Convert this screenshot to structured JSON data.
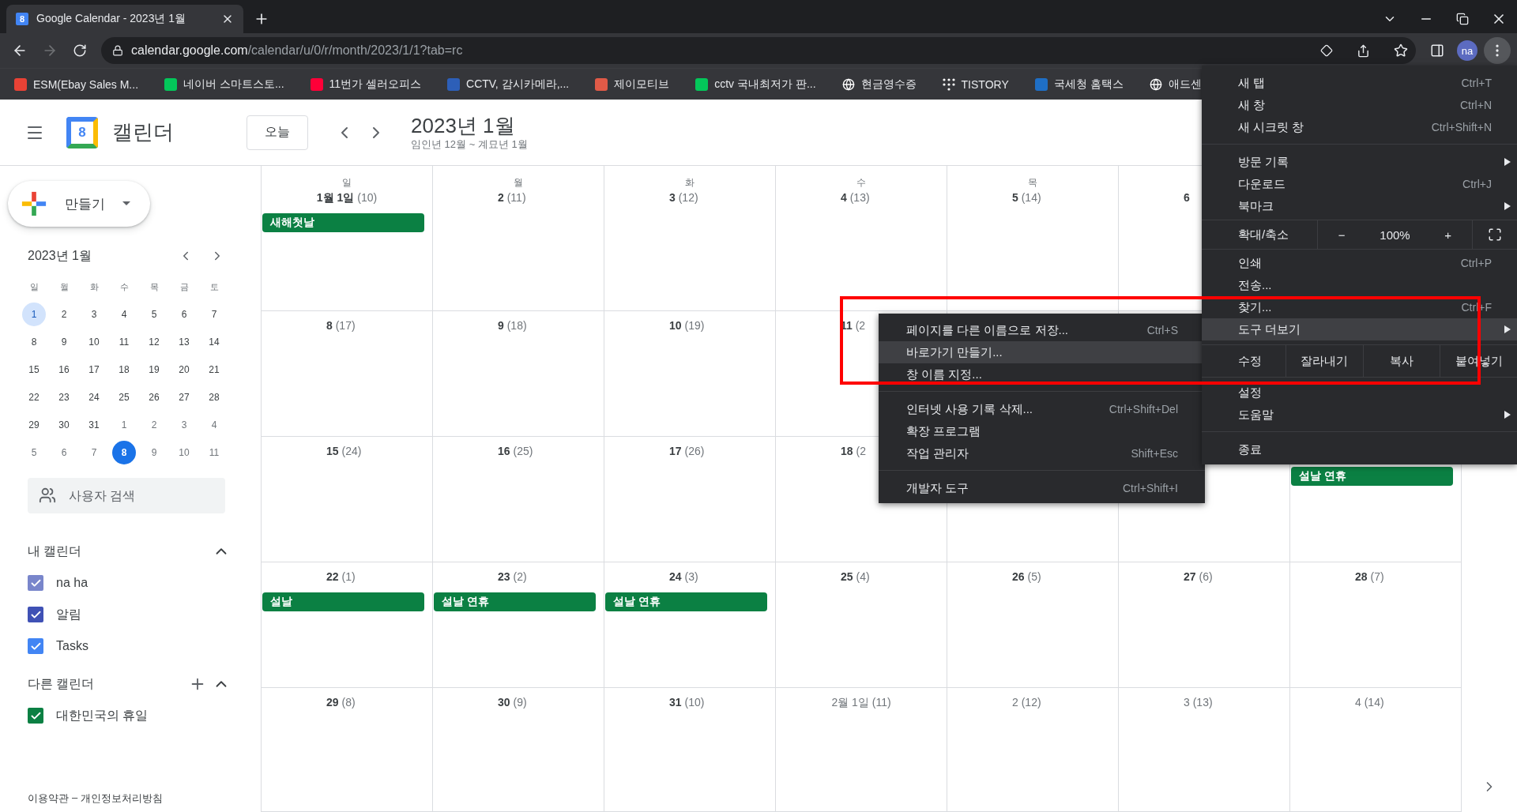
{
  "browser": {
    "tab": {
      "favicon_text": "8",
      "title": "Google Calendar - 2023년 1월"
    },
    "address": {
      "host": "calendar.google.com",
      "path": "/calendar/u/0/r/month/2023/1/1?tab=rc"
    },
    "profile": "na",
    "bookmarks": [
      {
        "kind": "square",
        "color": "#e94235",
        "label": "ESM(Ebay Sales M..."
      },
      {
        "kind": "square",
        "color": "#03c75a",
        "label": "네이버 스마트스토..."
      },
      {
        "kind": "square",
        "color": "#ff0038",
        "label": "11번가 셀러오피스"
      },
      {
        "kind": "square",
        "color": "#2d5fb8",
        "label": "CCTV, 감시카메라,..."
      },
      {
        "kind": "square",
        "color": "#e05a47",
        "label": "제이모티브"
      },
      {
        "kind": "square",
        "color": "#03c75a",
        "label": "cctv 국내최저가 판..."
      },
      {
        "kind": "globe",
        "color": "#ffffff",
        "label": "현금영수증"
      },
      {
        "kind": "dots",
        "color": "#ffffff",
        "label": "TISTORY"
      },
      {
        "kind": "square",
        "color": "#1f6fc5",
        "label": "국세청 홈택스"
      },
      {
        "kind": "globe",
        "color": "#ffffff",
        "label": "애드센"
      }
    ]
  },
  "app": {
    "logo_text": "8",
    "name": "캘린더",
    "today_button": "오늘",
    "title": "2023년 1월",
    "subtitle": "임인년 12월 ~ 계묘년 1월"
  },
  "sidebar": {
    "create_button": "만들기",
    "mini_calendar": {
      "title": "2023년 1월",
      "weekdays": [
        "일",
        "월",
        "화",
        "수",
        "목",
        "금",
        "토"
      ],
      "weeks": [
        [
          {
            "day": "1",
            "outside": false,
            "selected": true,
            "today": false
          },
          {
            "day": "2",
            "outside": false,
            "selected": false,
            "today": false
          },
          {
            "day": "3",
            "outside": false,
            "selected": false,
            "today": false
          },
          {
            "day": "4",
            "outside": false,
            "selected": false,
            "today": false
          },
          {
            "day": "5",
            "outside": false,
            "selected": false,
            "today": false
          },
          {
            "day": "6",
            "outside": false,
            "selected": false,
            "today": false
          },
          {
            "day": "7",
            "outside": false,
            "selected": false,
            "today": false
          }
        ],
        [
          {
            "day": "8",
            "outside": false,
            "selected": false,
            "today": false
          },
          {
            "day": "9",
            "outside": false,
            "selected": false,
            "today": false
          },
          {
            "day": "10",
            "outside": false,
            "selected": false,
            "today": false
          },
          {
            "day": "11",
            "outside": false,
            "selected": false,
            "today": false
          },
          {
            "day": "12",
            "outside": false,
            "selected": false,
            "today": false
          },
          {
            "day": "13",
            "outside": false,
            "selected": false,
            "today": false
          },
          {
            "day": "14",
            "outside": false,
            "selected": false,
            "today": false
          }
        ],
        [
          {
            "day": "15",
            "outside": false,
            "selected": false,
            "today": false
          },
          {
            "day": "16",
            "outside": false,
            "selected": false,
            "today": false
          },
          {
            "day": "17",
            "outside": false,
            "selected": false,
            "today": false
          },
          {
            "day": "18",
            "outside": false,
            "selected": false,
            "today": false
          },
          {
            "day": "19",
            "outside": false,
            "selected": false,
            "today": false
          },
          {
            "day": "20",
            "outside": false,
            "selected": false,
            "today": false
          },
          {
            "day": "21",
            "outside": false,
            "selected": false,
            "today": false
          }
        ],
        [
          {
            "day": "22",
            "outside": false,
            "selected": false,
            "today": false
          },
          {
            "day": "23",
            "outside": false,
            "selected": false,
            "today": false
          },
          {
            "day": "24",
            "outside": false,
            "selected": false,
            "today": false
          },
          {
            "day": "25",
            "outside": false,
            "selected": false,
            "today": false
          },
          {
            "day": "26",
            "outside": false,
            "selected": false,
            "today": false
          },
          {
            "day": "27",
            "outside": false,
            "selected": false,
            "today": false
          },
          {
            "day": "28",
            "outside": false,
            "selected": false,
            "today": false
          }
        ],
        [
          {
            "day": "29",
            "outside": false,
            "selected": false,
            "today": false
          },
          {
            "day": "30",
            "outside": false,
            "selected": false,
            "today": false
          },
          {
            "day": "31",
            "outside": false,
            "selected": false,
            "today": false
          },
          {
            "day": "1",
            "outside": true,
            "selected": false,
            "today": false
          },
          {
            "day": "2",
            "outside": true,
            "selected": false,
            "today": false
          },
          {
            "day": "3",
            "outside": true,
            "selected": false,
            "today": false
          },
          {
            "day": "4",
            "outside": true,
            "selected": false,
            "today": false
          }
        ],
        [
          {
            "day": "5",
            "outside": true,
            "selected": false,
            "today": false
          },
          {
            "day": "6",
            "outside": true,
            "selected": false,
            "today": false
          },
          {
            "day": "7",
            "outside": true,
            "selected": false,
            "today": false
          },
          {
            "day": "8",
            "outside": true,
            "selected": false,
            "today": true
          },
          {
            "day": "9",
            "outside": true,
            "selected": false,
            "today": false
          },
          {
            "day": "10",
            "outside": true,
            "selected": false,
            "today": false
          },
          {
            "day": "11",
            "outside": true,
            "selected": false,
            "today": false
          }
        ]
      ]
    },
    "people_search": {
      "placeholder": "사용자 검색"
    },
    "my_calendars": {
      "title": "내 캘린더",
      "expanded": true,
      "items": [
        {
          "label": "na ha",
          "checked": true,
          "color": "#7986cb"
        },
        {
          "label": "알림",
          "checked": true,
          "color": "#3f51b5"
        },
        {
          "label": "Tasks",
          "checked": true,
          "color": "#4285f4"
        }
      ]
    },
    "other_calendars": {
      "title": "다른 캘린더",
      "expanded": true,
      "items": [
        {
          "label": "대한민국의 휴일",
          "checked": true,
          "color": "#0b8043"
        }
      ]
    },
    "footer": {
      "terms": "이용약관",
      "separator": "–",
      "privacy": "개인정보처리방침"
    }
  },
  "month": {
    "weekdays": [
      "일",
      "월",
      "화",
      "수",
      "목"
    ],
    "weeks": [
      {
        "days": [
          {
            "date": "1월 1일",
            "lunar": "(10)",
            "outside": false,
            "events": [
              {
                "title": "새해첫날"
              }
            ]
          },
          {
            "date": "2",
            "lunar": "(11)",
            "outside": false
          },
          {
            "date": "3",
            "lunar": "(12)",
            "outside": false
          },
          {
            "date": "4",
            "lunar": "(13)",
            "outside": false
          },
          {
            "date": "5",
            "lunar": "(14)",
            "outside": false
          },
          {
            "date": "6",
            "outside": false
          }
        ]
      },
      {
        "days": [
          {
            "date": "8",
            "lunar": "(17)",
            "outside": false
          },
          {
            "date": "9",
            "lunar": "(18)",
            "outside": false
          },
          {
            "date": "10",
            "lunar": "(19)",
            "outside": false
          },
          {
            "date": "11",
            "lunar": "(2",
            "outside": false
          }
        ]
      },
      {
        "days": [
          {
            "date": "15",
            "lunar": "(24)",
            "outside": false
          },
          {
            "date": "16",
            "lunar": "(25)",
            "outside": false
          },
          {
            "date": "17",
            "lunar": "(26)",
            "outside": false
          },
          {
            "date": "18",
            "lunar": "(2",
            "outside": false
          }
        ],
        "end_days": [
          {
            "events": [
              {
                "title": "설날 연휴"
              }
            ]
          }
        ]
      },
      {
        "days": [
          {
            "date": "22",
            "lunar": "(1)",
            "outside": false,
            "events": [
              {
                "title": "설날"
              }
            ]
          },
          {
            "date": "23",
            "lunar": "(2)",
            "outside": false,
            "events": [
              {
                "title": "설날 연휴"
              }
            ]
          },
          {
            "date": "24",
            "lunar": "(3)",
            "outside": false,
            "events": [
              {
                "title": "설날 연휴"
              }
            ]
          },
          {
            "date": "25",
            "lunar": "(4)",
            "outside": false
          },
          {
            "date": "26",
            "lunar": "(5)",
            "outside": false
          },
          {
            "date": "27",
            "lunar": "(6)",
            "outside": false
          },
          {
            "date": "28",
            "lunar": "(7)",
            "outside": false
          }
        ]
      },
      {
        "days": [
          {
            "date": "29",
            "lunar": "(8)",
            "outside": false
          },
          {
            "date": "30",
            "lunar": "(9)",
            "outside": false
          },
          {
            "date": "31",
            "lunar": "(10)",
            "outside": false
          },
          {
            "date": "2월 1일",
            "lunar": "(11)",
            "outside": true
          },
          {
            "date": "2",
            "lunar": "(12)",
            "outside": true
          },
          {
            "date": "3",
            "lunar": "(13)",
            "outside": true
          },
          {
            "date": "4",
            "lunar": "(14)",
            "outside": true
          }
        ]
      }
    ]
  },
  "chrome_menu": {
    "items": [
      {
        "kind": "item",
        "label": "새 탭",
        "shortcut": "Ctrl+T",
        "selected": false
      },
      {
        "kind": "item",
        "label": "새 창",
        "shortcut": "Ctrl+N",
        "selected": false
      },
      {
        "kind": "item",
        "label": "새 시크릿 창",
        "shortcut": "Ctrl+Shift+N",
        "selected": false
      },
      {
        "kind": "separator"
      },
      {
        "kind": "submenu",
        "label": "방문 기록",
        "selected": false
      },
      {
        "kind": "item",
        "label": "다운로드",
        "shortcut": "Ctrl+J",
        "selected": false
      },
      {
        "kind": "submenu",
        "label": "북마크",
        "selected": false
      },
      {
        "kind": "zoom",
        "label": "확대/축소",
        "minus": "−",
        "value": "100%",
        "plus": "+"
      },
      {
        "kind": "item",
        "label": "인쇄",
        "shortcut": "Ctrl+P",
        "selected": false
      },
      {
        "kind": "item",
        "label": "전송...",
        "selected": false
      },
      {
        "kind": "item",
        "label": "찾기...",
        "shortcut": "Ctrl+F",
        "selected": false
      },
      {
        "kind": "submenu",
        "label": "도구 더보기",
        "selected": true
      },
      {
        "kind": "edit",
        "label": "수정",
        "buttons": [
          "잘라내기",
          "복사",
          "붙여넣기"
        ]
      },
      {
        "kind": "item",
        "label": "설정",
        "selected": false
      },
      {
        "kind": "submenu",
        "label": "도움말",
        "selected": false
      },
      {
        "kind": "separator"
      },
      {
        "kind": "item",
        "label": "종료",
        "selected": false
      }
    ]
  },
  "tools_submenu": {
    "items": [
      {
        "kind": "item",
        "label": "페이지를 다른 이름으로 저장...",
        "shortcut": "Ctrl+S",
        "selected": false
      },
      {
        "kind": "item",
        "label": "바로가기 만들기...",
        "selected": true
      },
      {
        "kind": "item",
        "label": "창 이름 지정...",
        "selected": false
      },
      {
        "kind": "separator"
      },
      {
        "kind": "item",
        "label": "인터넷 사용 기록 삭제...",
        "shortcut": "Ctrl+Shift+Del",
        "selected": false
      },
      {
        "kind": "item",
        "label": "확장 프로그램",
        "selected": false
      },
      {
        "kind": "item",
        "label": "작업 관리자",
        "shortcut": "Shift+Esc",
        "selected": false
      },
      {
        "kind": "separator"
      },
      {
        "kind": "item",
        "label": "개발자 도구",
        "shortcut": "Ctrl+Shift+I",
        "selected": false
      }
    ]
  }
}
